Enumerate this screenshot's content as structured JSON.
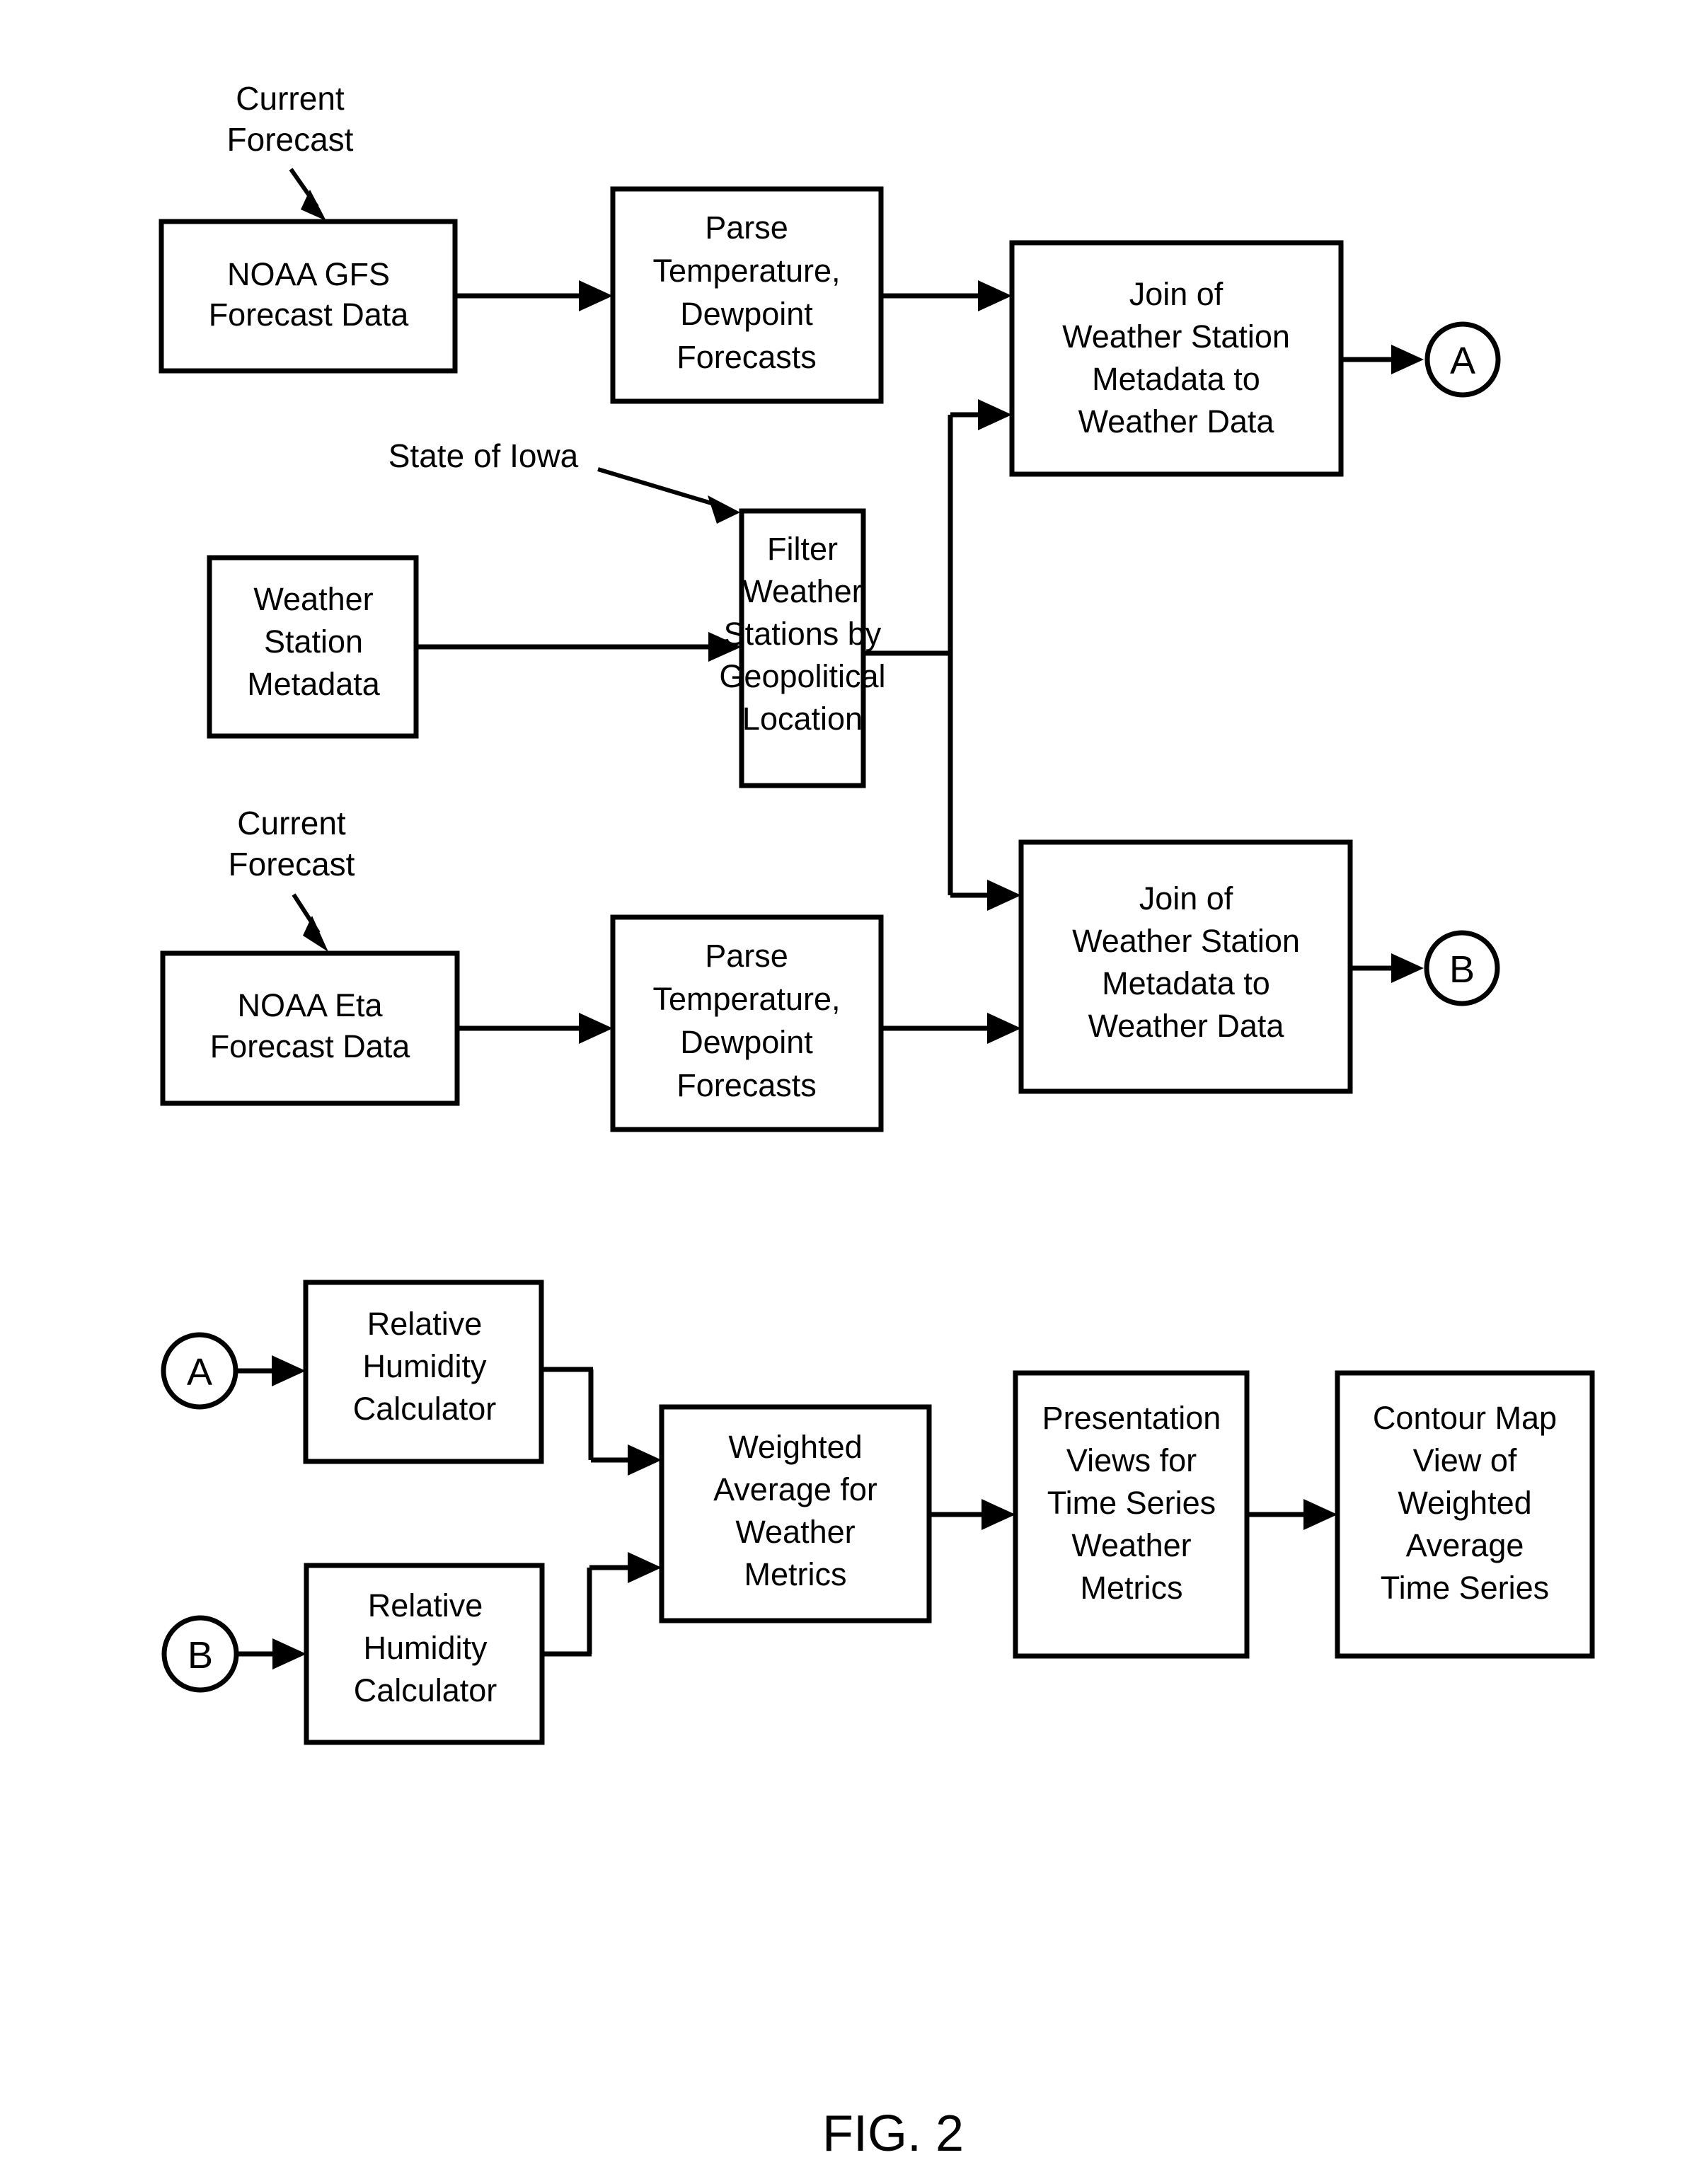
{
  "figure": {
    "caption": "FIG. 2",
    "title": "Weather forecast data processing flow diagram"
  },
  "annotations": [
    {
      "id": "annot-current-forecast-gfs",
      "line1": "Current",
      "line2": "Forecast"
    },
    {
      "id": "annot-state-of-iowa",
      "line1": "State of Iowa",
      "line2": ""
    },
    {
      "id": "annot-current-forecast-eta",
      "line1": "Current",
      "line2": "Forecast"
    }
  ],
  "nodes": {
    "noaa_gfs": {
      "lines": [
        "NOAA GFS",
        "Forecast Data"
      ]
    },
    "parse_gfs": {
      "lines": [
        "Parse",
        "Temperature,",
        "Dewpoint",
        "Forecasts"
      ]
    },
    "join_a": {
      "lines": [
        "Join of",
        "Weather Station",
        "Metadata to",
        "Weather Data"
      ]
    },
    "weather_station_metadata": {
      "lines": [
        "Weather",
        "Station",
        "Metadata"
      ]
    },
    "filter_stations": {
      "lines": [
        "Filter",
        "Weather",
        "Stations by",
        "Geopolitical",
        "Location"
      ]
    },
    "noaa_eta": {
      "lines": [
        "NOAA Eta",
        "Forecast Data"
      ]
    },
    "parse_eta": {
      "lines": [
        "Parse",
        "Temperature,",
        "Dewpoint",
        "Forecasts"
      ]
    },
    "join_b": {
      "lines": [
        "Join of",
        "Weather Station",
        "Metadata to",
        "Weather Data"
      ]
    },
    "rh_calc_a": {
      "lines": [
        "Relative",
        "Humidity",
        "Calculator"
      ]
    },
    "rh_calc_b": {
      "lines": [
        "Relative",
        "Humidity",
        "Calculator"
      ]
    },
    "weighted_average": {
      "lines": [
        "Weighted",
        "Average for",
        "Weather",
        "Metrics"
      ]
    },
    "presentation_views": {
      "lines": [
        "Presentation",
        "Views for",
        "Time Series",
        "Weather",
        "Metrics"
      ]
    },
    "contour_map": {
      "lines": [
        "Contour Map",
        "View of",
        "Weighted",
        "Average",
        "Time Series"
      ]
    }
  },
  "connectors": {
    "a_out": {
      "label": "A"
    },
    "b_out": {
      "label": "B"
    },
    "a_in": {
      "label": "A"
    },
    "b_in": {
      "label": "B"
    }
  },
  "colors": {
    "stroke": "#000000",
    "fill": "#ffffff",
    "text": "#000000"
  }
}
